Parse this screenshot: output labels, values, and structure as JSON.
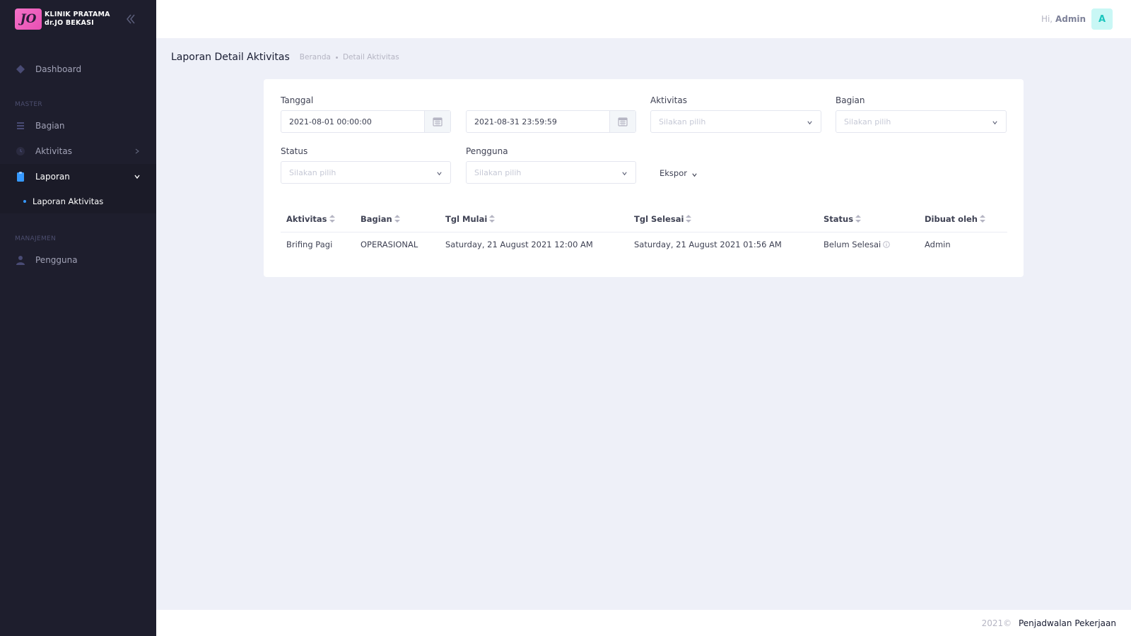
{
  "brand": {
    "logo_text": "JO",
    "line1": "KLINIK PRATAMA",
    "line2": "dr.JO BEKASI"
  },
  "sidebar": {
    "dashboard": "Dashboard",
    "section_master": "MASTER",
    "bagian": "Bagian",
    "aktivitas": "Aktivitas",
    "laporan": "Laporan",
    "laporan_aktivitas": "Laporan Aktivitas",
    "section_manajemen": "MANAJEMEN",
    "pengguna": "Pengguna"
  },
  "header": {
    "greeting_prefix": "Hi,",
    "user": "Admin",
    "avatar_letter": "A"
  },
  "page": {
    "title": "Laporan Detail Aktivitas",
    "breadcrumb": [
      "Beranda",
      "Detail Aktivitas"
    ]
  },
  "filters": {
    "tanggal_label": "Tanggal",
    "date_start": "2021-08-01 00:00:00",
    "date_end": "2021-08-31 23:59:59",
    "aktivitas_label": "Aktivitas",
    "aktivitas_placeholder": "Silakan pilih",
    "bagian_label": "Bagian",
    "bagian_placeholder": "Silakan pilih",
    "status_label": "Status",
    "status_placeholder": "Silakan pilih",
    "pengguna_label": "Pengguna",
    "pengguna_placeholder": "Silakan pilih",
    "ekspor": "Ekspor"
  },
  "table": {
    "headers": [
      "Aktivitas",
      "Bagian",
      "Tgl Mulai",
      "Tgl Selesai",
      "Status",
      "Dibuat oleh"
    ],
    "rows": [
      [
        "Brifing Pagi",
        "OPERASIONAL",
        "Saturday, 21 August 2021 12:00 AM",
        "Saturday, 21 August 2021 01:56 AM",
        "Belum Selesai",
        "Admin"
      ]
    ]
  },
  "footer": {
    "year": "2021©",
    "app": "Penjadwalan Pekerjaan"
  },
  "colors": {
    "sidebar": "#1e1e2d",
    "primary": "#3699ff",
    "avatar_bg": "#c9f7f5",
    "avatar_fg": "#1bc5bd"
  },
  "icons": [
    "layers-icon",
    "list-icon",
    "clock-icon",
    "clipboard-icon",
    "user-icon",
    "calendar-icon",
    "chevron-down-icon",
    "sort-icon",
    "info-icon",
    "double-chevron-left-icon"
  ]
}
